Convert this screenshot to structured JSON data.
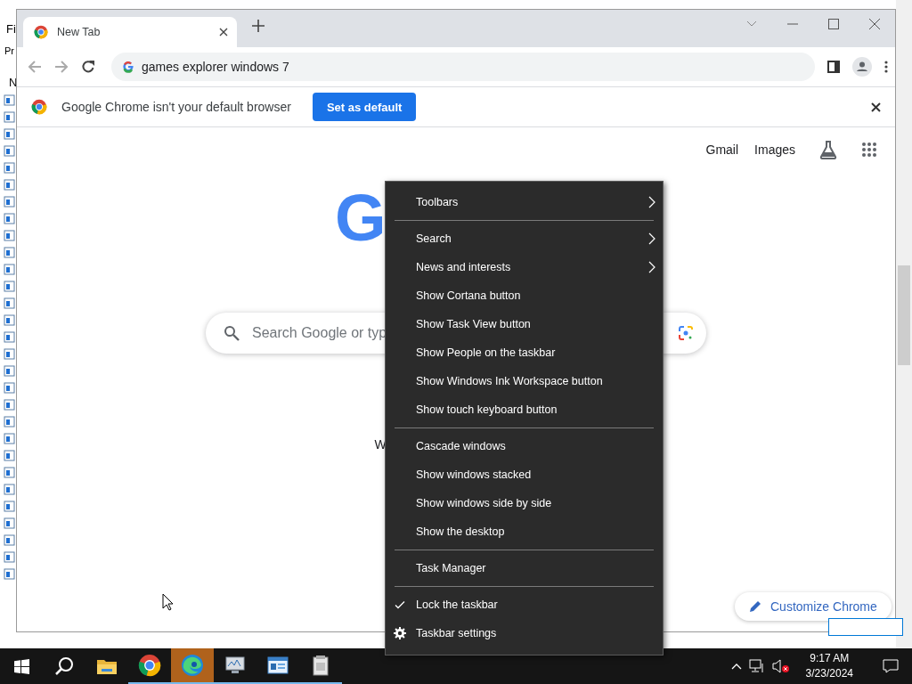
{
  "background_window": {
    "menu_fragments": [
      "Fi",
      "Pr"
    ],
    "column_fragment": "N"
  },
  "browser": {
    "tabs": [
      {
        "title": "New Tab",
        "selected": true
      }
    ],
    "address": "games explorer windows 7",
    "infobar": {
      "message": "Google Chrome isn't your default browser",
      "button": "Set as default"
    },
    "links": [
      "Gmail",
      "Images"
    ],
    "logo_fragment": "G",
    "search_placeholder": "Search Google or typ",
    "text_fragment": "W",
    "customize_button": "Customize Chrome"
  },
  "context_menu": [
    {
      "kind": "item",
      "label": "Toolbars",
      "submenu": true,
      "checked": false
    },
    {
      "kind": "separator"
    },
    {
      "kind": "item",
      "label": "Search",
      "submenu": true,
      "checked": false
    },
    {
      "kind": "item",
      "label": "News and interests",
      "submenu": true,
      "checked": false
    },
    {
      "kind": "item",
      "label": "Show Cortana button",
      "submenu": false,
      "checked": false
    },
    {
      "kind": "item",
      "label": "Show Task View button",
      "submenu": false,
      "checked": false
    },
    {
      "kind": "item",
      "label": "Show People on the taskbar",
      "submenu": false,
      "checked": false
    },
    {
      "kind": "item",
      "label": "Show Windows Ink Workspace button",
      "submenu": false,
      "checked": false
    },
    {
      "kind": "item",
      "label": "Show touch keyboard button",
      "submenu": false,
      "checked": false
    },
    {
      "kind": "separator"
    },
    {
      "kind": "item",
      "label": "Cascade windows",
      "submenu": false,
      "checked": false
    },
    {
      "kind": "item",
      "label": "Show windows stacked",
      "submenu": false,
      "checked": false
    },
    {
      "kind": "item",
      "label": "Show windows side by side",
      "submenu": false,
      "checked": false
    },
    {
      "kind": "item",
      "label": "Show the desktop",
      "submenu": false,
      "checked": false
    },
    {
      "kind": "separator"
    },
    {
      "kind": "item",
      "label": "Task Manager",
      "submenu": false,
      "checked": false
    },
    {
      "kind": "separator"
    },
    {
      "kind": "item",
      "label": "Lock the taskbar",
      "submenu": false,
      "checked": true
    },
    {
      "kind": "settings",
      "label": "Taskbar settings",
      "submenu": false,
      "checked": false
    }
  ],
  "taskbar": {
    "apps": [
      {
        "kind": "explorer",
        "running": false,
        "selected": false
      },
      {
        "kind": "chrome",
        "running": true,
        "selected": false
      },
      {
        "kind": "edge",
        "running": true,
        "selected": true
      },
      {
        "kind": "monitor",
        "running": true,
        "selected": false
      },
      {
        "kind": "panel",
        "running": true,
        "selected": false
      },
      {
        "kind": "document",
        "running": true,
        "selected": false
      }
    ],
    "time": "9:17 AM",
    "date": "3/23/2024"
  }
}
